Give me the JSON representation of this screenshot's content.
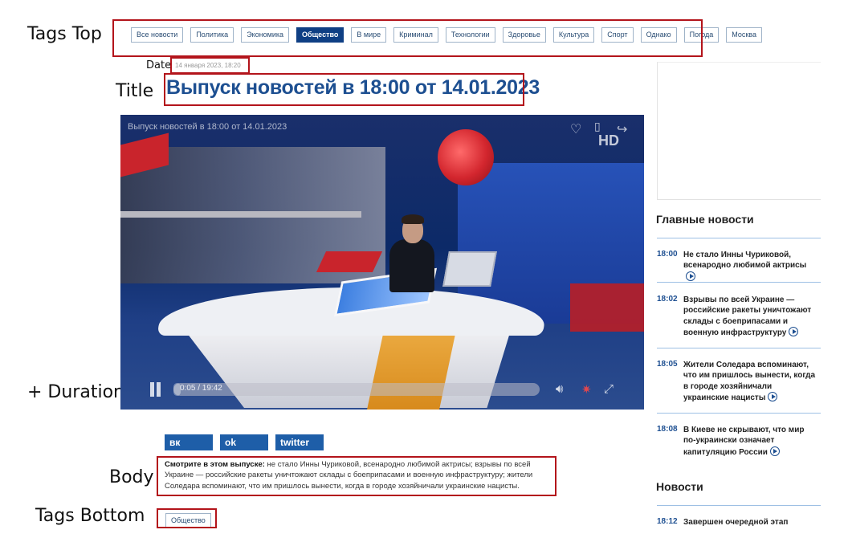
{
  "annotations": {
    "tags_top": "Tags Top",
    "date": "Date",
    "title": "Title",
    "duration": "+ Duration",
    "body": "Body",
    "tags_bottom": "Tags Bottom"
  },
  "tags_top": [
    "Все новости",
    "Политика",
    "Экономика",
    "Общество",
    "В мире",
    "Криминал",
    "Технологии",
    "Здоровье",
    "Культура",
    "Спорт",
    "Однако",
    "Погода",
    "Москва"
  ],
  "active_tag": "Общество",
  "article": {
    "date": "14 января 2023, 18:20",
    "title": "Выпуск новостей в 18:00 от 14.01.2023",
    "body_lead": "Смотрите в этом выпуске:",
    "body": " не стало Инны Чуриковой, всенародно любимой актрисы; взрывы по всей Украине — российские ракеты уничтожают склады с боеприпасами и военную инфраструктуру; жители Соледара вспоминают, что им пришлось вынести, когда в городе хозяйничали украинские нацисты.",
    "tag_bottom": "Общество"
  },
  "video": {
    "caption": "Выпуск новостей в 18:00 от 14.01.2023",
    "time": "0:05 / 19:42",
    "progress": 0.004,
    "hd_label": "HD",
    "icons": [
      "heart-icon",
      "bookmark-icon",
      "share-icon",
      "pause-icon",
      "volume-icon",
      "settings-icon",
      "fullscreen-icon"
    ]
  },
  "share": {
    "vk": "вк",
    "ok": "ok",
    "twitter": "twitter"
  },
  "sidebar": {
    "main_heading": "Главные новости",
    "main_news": [
      {
        "time": "18:00",
        "text": "Не стало Инны Чуриковой, всенародно любимой актрисы"
      },
      {
        "time": "18:02",
        "text": "Взрывы по всей Украине — российские ракеты уничтожают склады с боеприпасами и военную инфраструктуру"
      },
      {
        "time": "18:05",
        "text": "Жители Соледара вспоминают, что им пришлось вынести, когда в городе хозяйничали украинские нацисты"
      },
      {
        "time": "18:08",
        "text": "В Киеве не скрывают, что мир по-украински означает капитуляцию России"
      }
    ],
    "news_heading": "Новости",
    "news": [
      {
        "time": "18:12",
        "text": "Завершен очередной этап"
      }
    ]
  },
  "colors": {
    "annotation_box": "#b3141b",
    "brand_blue": "#1d4f91",
    "active_tag_bg": "#0f3f84"
  }
}
